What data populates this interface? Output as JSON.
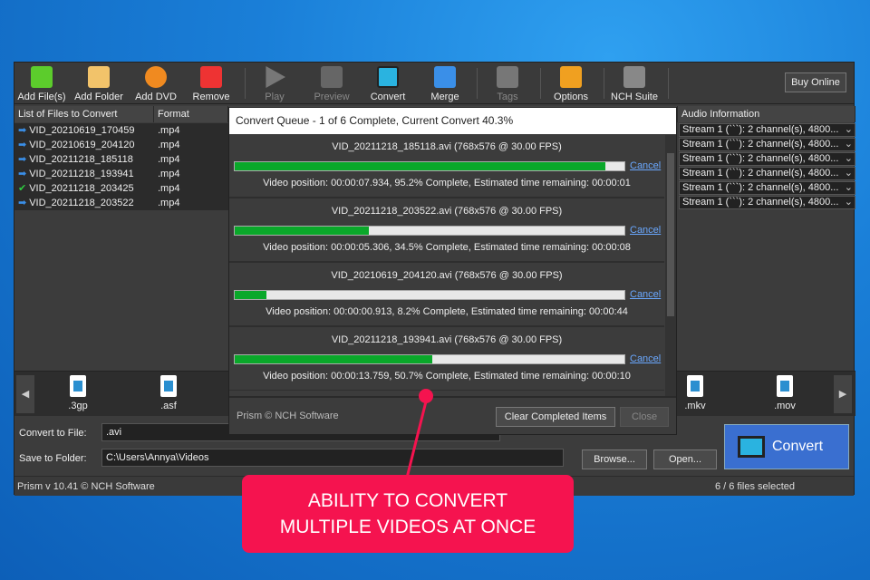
{
  "toolbar": {
    "items": [
      "Add File(s)",
      "Add Folder",
      "Add DVD",
      "Remove",
      "Play",
      "Preview",
      "Convert",
      "Merge",
      "Tags",
      "Options",
      "NCH Suite"
    ],
    "buy": "Buy Online"
  },
  "columns": {
    "files": "List of Files to Convert",
    "format": "Format",
    "audio": "Audio Information"
  },
  "files": [
    {
      "name": "VID_20210619_170459",
      "format": ".mp4",
      "done": false,
      "audio": "Stream 1 (```): 2 channel(s), 4800..."
    },
    {
      "name": "VID_20210619_204120",
      "format": ".mp4",
      "done": false,
      "audio": "Stream 1 (```): 2 channel(s), 4800..."
    },
    {
      "name": "VID_20211218_185118",
      "format": ".mp4",
      "done": false,
      "audio": "Stream 1 (```): 2 channel(s), 4800..."
    },
    {
      "name": "VID_20211218_193941",
      "format": ".mp4",
      "done": false,
      "audio": "Stream 1 (```): 2 channel(s), 4800..."
    },
    {
      "name": "VID_20211218_203425",
      "format": ".mp4",
      "done": true,
      "audio": "Stream 1 (```): 2 channel(s), 4800..."
    },
    {
      "name": "VID_20211218_203522",
      "format": ".mp4",
      "done": false,
      "audio": "Stream 1 (```): 2 channel(s), 4800..."
    }
  ],
  "formats": [
    ".3gp",
    ".asf",
    ".mkv",
    ".mov"
  ],
  "convert_to": {
    "label": "Convert to File:",
    "value": ".avi"
  },
  "save_to": {
    "label": "Save to Folder:",
    "value": "C:\\Users\\Annya\\Videos",
    "browse": "Browse...",
    "open": "Open..."
  },
  "convert_button": "Convert",
  "status": {
    "version": "Prism v 10.41 © NCH Software",
    "selected": "6 / 6 files selected"
  },
  "dialog": {
    "title": "Convert Queue - 1 of 6 Complete, Current Convert 40.3%",
    "cancel": "Cancel",
    "items": [
      {
        "name": "VID_20211218_185118.avi (768x576 @ 30.00 FPS)",
        "progress": 95.2,
        "info": "Video position:  00:00:07.934, 95.2% Complete, Estimated time remaining: 00:00:01"
      },
      {
        "name": "VID_20211218_203522.avi (768x576 @ 30.00 FPS)",
        "progress": 34.5,
        "info": "Video position:  00:00:05.306, 34.5% Complete, Estimated time remaining: 00:00:08"
      },
      {
        "name": "VID_20210619_204120.avi (768x576 @ 30.00 FPS)",
        "progress": 8.2,
        "info": "Video position:  00:00:00.913, 8.2% Complete, Estimated time remaining: 00:00:44"
      },
      {
        "name": "VID_20211218_193941.avi (768x576 @ 30.00 FPS)",
        "progress": 50.7,
        "info": "Video position:  00:00:13.759, 50.7% Complete, Estimated time remaining: 00:00:10"
      }
    ],
    "footer": "Prism © NCH Software",
    "clear": "Clear Completed Items",
    "close": "Close"
  },
  "callout": {
    "line1": "ABILITY TO CONVERT",
    "line2": "MULTIPLE VIDEOS AT ONCE"
  }
}
